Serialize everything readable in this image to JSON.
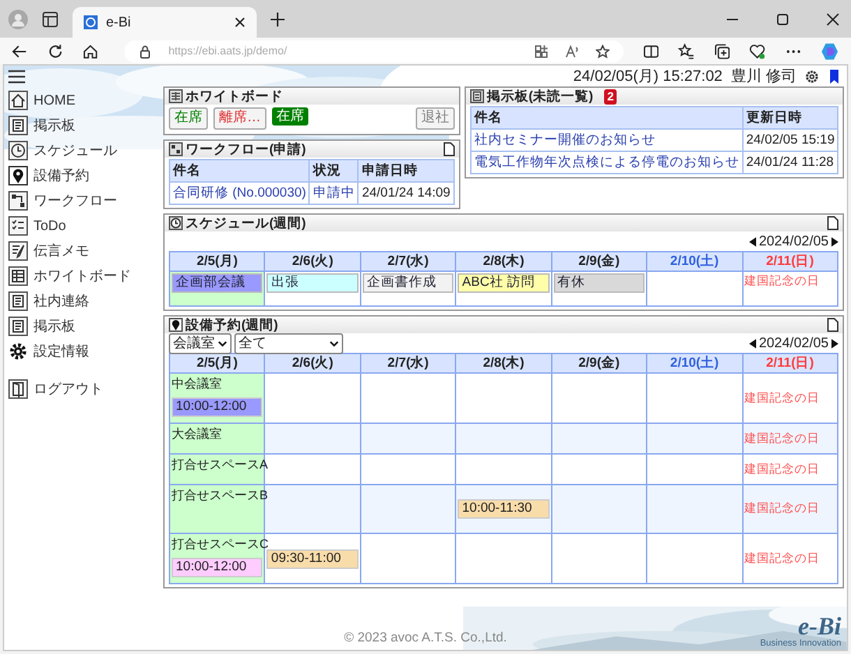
{
  "browser": {
    "tab_title": "e-Bi",
    "url": "https://ebi.aats.jp/demo/"
  },
  "header": {
    "datetime": "24/02/05(月) 15:27:02",
    "user": "豊川 修司"
  },
  "sidebar": {
    "items": [
      {
        "label": "HOME"
      },
      {
        "label": "掲示板"
      },
      {
        "label": "スケジュール"
      },
      {
        "label": "設備予約"
      },
      {
        "label": "ワークフロー"
      },
      {
        "label": "ToDo"
      },
      {
        "label": "伝言メモ"
      },
      {
        "label": "ホワイトボード"
      },
      {
        "label": "社内連絡"
      },
      {
        "label": "掲示板"
      },
      {
        "label": "設定情報"
      }
    ],
    "logout": "ログアウト"
  },
  "whiteboard": {
    "title": "ホワイトボード",
    "buttons": [
      {
        "label": "在席",
        "kind": "status",
        "color": "#008000",
        "selected": false
      },
      {
        "label": "離席…",
        "kind": "status",
        "color": "#e03030",
        "selected": false
      },
      {
        "label": "在席",
        "kind": "status",
        "color": "#008000",
        "selected": true
      },
      {
        "label": "退社",
        "kind": "checkout",
        "color": "#808080",
        "selected": false
      }
    ]
  },
  "workflow": {
    "title": "ワークフロー(申請)",
    "columns": [
      "件名",
      "状況",
      "申請日時"
    ],
    "rows": [
      {
        "subject": "合同研修 (No.000030)",
        "status": "申請中",
        "date": "24/01/24 14:09"
      }
    ]
  },
  "bulletin": {
    "title": "掲示板(未読一覧)",
    "badge": "2",
    "columns": [
      "件名",
      "更新日時"
    ],
    "rows": [
      {
        "subject": "社内セミナー開催のお知らせ",
        "date": "24/02/05 15:19"
      },
      {
        "subject": "電気工作物年次点検による停電のお知らせ",
        "date": "24/01/24 11:28"
      }
    ]
  },
  "schedule": {
    "title": "スケジュール(週間)",
    "date": "2024/02/05",
    "days": [
      {
        "label": "2/5(月)",
        "kind": "weekday",
        "today": true,
        "events": [
          {
            "text": "企画部会議",
            "color": "#9999ff"
          }
        ]
      },
      {
        "label": "2/6(火)",
        "kind": "weekday",
        "today": false,
        "events": [
          {
            "text": "出張",
            "color": "#ccffff"
          }
        ]
      },
      {
        "label": "2/7(水)",
        "kind": "weekday",
        "today": false,
        "events": [
          {
            "text": "企画書作成",
            "color": "#f2f2f2"
          }
        ]
      },
      {
        "label": "2/8(木)",
        "kind": "weekday",
        "today": false,
        "events": [
          {
            "text": "ABC社 訪問",
            "color": "#ffffaa"
          }
        ]
      },
      {
        "label": "2/9(金)",
        "kind": "weekday",
        "today": false,
        "events": [
          {
            "text": "有休",
            "color": "#d9d9d9"
          }
        ]
      },
      {
        "label": "2/10(土)",
        "kind": "saturday",
        "today": false
      },
      {
        "label": "2/11(日)",
        "kind": "sunday",
        "today": false,
        "holiday": "建国記念の日"
      }
    ]
  },
  "facility": {
    "title": "設備予約(週間)",
    "category": "会議室",
    "filter": "全て",
    "date": "2024/02/05",
    "days": [
      {
        "label": "2/5(月)",
        "kind": "weekday",
        "today": true
      },
      {
        "label": "2/6(火)",
        "kind": "weekday",
        "today": false
      },
      {
        "label": "2/7(水)",
        "kind": "weekday",
        "today": false
      },
      {
        "label": "2/8(木)",
        "kind": "weekday",
        "today": false
      },
      {
        "label": "2/9(金)",
        "kind": "weekday",
        "today": false
      },
      {
        "label": "2/10(土)",
        "kind": "saturday",
        "today": false
      },
      {
        "label": "2/11(日)",
        "kind": "sunday",
        "today": false
      }
    ],
    "rooms": [
      {
        "name": "中会議室",
        "cells": [
          {
            "items": [
              {
                "kind": "booking",
                "text": "10:00-12:00",
                "color": "#9999ff"
              }
            ]
          },
          {},
          {},
          {},
          {},
          {},
          {
            "items": [
              {
                "kind": "holiday",
                "text": "建国記念の日"
              }
            ]
          }
        ]
      },
      {
        "name": "大会議室",
        "cells": [
          {},
          {},
          {},
          {},
          {},
          {},
          {
            "items": [
              {
                "kind": "holiday",
                "text": "建国記念の日"
              }
            ]
          }
        ]
      },
      {
        "name": "打合せスペースA",
        "cells": [
          {},
          {},
          {},
          {},
          {},
          {},
          {
            "items": [
              {
                "kind": "holiday",
                "text": "建国記念の日"
              }
            ]
          }
        ]
      },
      {
        "name": "打合せスペースB",
        "cells": [
          {},
          {},
          {},
          {
            "items": [
              {
                "kind": "booking",
                "text": "10:00-11:30",
                "color": "#f8dcaa"
              }
            ]
          },
          {},
          {},
          {
            "items": [
              {
                "kind": "holiday",
                "text": "建国記念の日"
              }
            ]
          }
        ]
      },
      {
        "name": "打合せスペースC",
        "cells": [
          {
            "items": [
              {
                "kind": "booking",
                "text": "10:00-12:00",
                "color": "#ffccff"
              }
            ]
          },
          {
            "items": [
              {
                "kind": "booking",
                "text": "09:30-11:00",
                "color": "#f8dcaa"
              }
            ]
          },
          {},
          {},
          {},
          {},
          {
            "items": [
              {
                "kind": "holiday",
                "text": "建国記念の日"
              }
            ]
          }
        ]
      }
    ]
  },
  "footer": {
    "copyright": "© 2023 avoc A.T.S. Co.,Ltd.",
    "logo": "e-Bi",
    "tagline": "Business Innovation"
  }
}
